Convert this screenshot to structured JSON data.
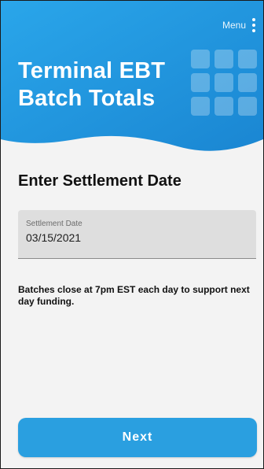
{
  "header": {
    "menu_label": "Menu",
    "title_line1": "Terminal EBT",
    "title_line2": "Batch Totals",
    "icons": [
      "vertical-dots-icon",
      "grid-icon"
    ]
  },
  "main": {
    "heading": "Enter Settlement Date",
    "settlement_field": {
      "label": "Settlement Date",
      "value": "03/15/2021"
    },
    "note": "Batches close at 7pm EST each day to support next day funding."
  },
  "footer": {
    "next_label": "Next"
  },
  "colors": {
    "primary_blue": "#2a9fe0",
    "hero_blue": "#1f8fd8",
    "background": "#f3f3f3",
    "field_background": "#dedede"
  }
}
